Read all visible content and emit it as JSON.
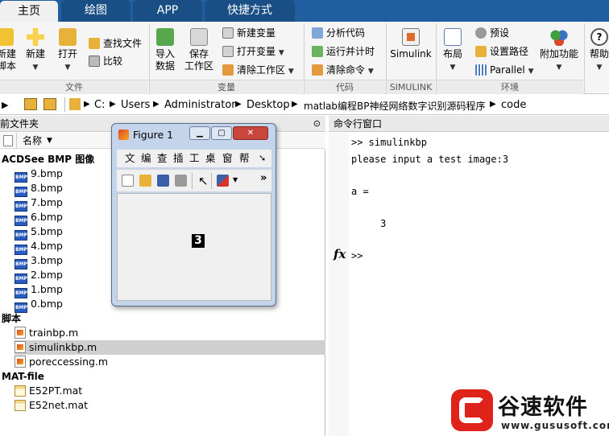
{
  "tabs": [
    {
      "label": "主页",
      "active": true
    },
    {
      "label": "绘图",
      "active": false
    },
    {
      "label": "APP",
      "active": false
    },
    {
      "label": "快捷方式",
      "active": false
    }
  ],
  "ribbon": {
    "file": {
      "new_script": "新建\n脚本",
      "new": "新建",
      "open": "打开",
      "find_files": "查找文件",
      "compare": "比较",
      "group": "文件"
    },
    "variable": {
      "import": "导入\n数据",
      "save_ws": "保存\n工作区",
      "new_var": "新建变量",
      "open_var": "打开变量",
      "clear_ws": "清除工作区",
      "group": "变量"
    },
    "code": {
      "analyze": "分析代码",
      "run_time": "运行并计时",
      "clear_cmd": "清除命令",
      "group": "代码"
    },
    "simulink": {
      "label": "Simulink",
      "group": "SIMULINK"
    },
    "env": {
      "layout": "布局",
      "prefs": "预设",
      "set_path": "设置路径",
      "parallel": "Parallel",
      "addons": "附加功能",
      "group": "环境"
    },
    "help": {
      "label": "帮助"
    }
  },
  "address": {
    "path": [
      "C:",
      "Users",
      "Administrator",
      "Desktop",
      "matlab编程BP神经网络数字识别源码程序",
      "code"
    ]
  },
  "current_folder": {
    "title": "前文件夹",
    "name_col": "名称",
    "sections": [
      {
        "header": "ACDSee BMP 图像",
        "files": [
          "9.bmp",
          "8.bmp",
          "7.bmp",
          "6.bmp",
          "5.bmp",
          "4.bmp",
          "3.bmp",
          "2.bmp",
          "1.bmp",
          "0.bmp"
        ]
      },
      {
        "header": "脚本",
        "files": [
          "trainbp.m",
          "simulinkbp.m",
          "poreccessing.m"
        ]
      },
      {
        "header": "MAT-file",
        "files": [
          "E52PT.mat",
          "E52net.mat"
        ]
      }
    ],
    "selected": "simulinkbp.m",
    "bmp_icon_text": "BMP"
  },
  "command_window": {
    "title": "命令行窗口",
    "lines": [
      ">> simulinkbp",
      "please input a test image:3",
      "",
      "a =",
      "",
      "     3"
    ],
    "prompt": ">>",
    "fx": "fx"
  },
  "figure": {
    "title": "Figure 1",
    "menu": [
      "文",
      "编",
      "查",
      "插",
      "工",
      "桌",
      "窗",
      "帮"
    ],
    "more": "»",
    "digit": "3"
  },
  "watermark": {
    "brand": "谷速软件",
    "url": "www.gususoft.com"
  },
  "colors": {
    "tab_bar": "#1f5fa0",
    "accent_red": "#e0231a"
  }
}
